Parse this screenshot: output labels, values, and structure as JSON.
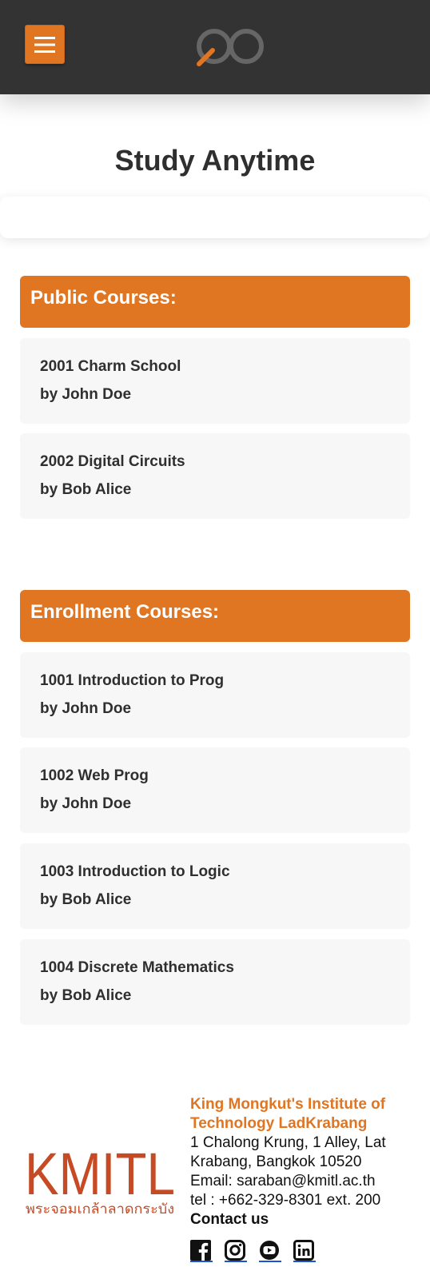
{
  "header": {
    "menu_icon": "hamburger-icon",
    "logo_icon": "infinity-logo-icon",
    "colors": {
      "bar": "#333333",
      "accent": "#e07522"
    }
  },
  "page": {
    "title": "Study Anytime"
  },
  "public_section": {
    "heading": "Public Courses:",
    "courses": [
      {
        "title": "2001 Charm School",
        "author": "by John Doe"
      },
      {
        "title": "2002 Digital Circuits",
        "author": "by Bob Alice"
      }
    ]
  },
  "enrollment_section": {
    "heading": "Enrollment Courses:",
    "courses": [
      {
        "title": "1001 Introduction to Prog",
        "author": "by John Doe"
      },
      {
        "title": "1002 Web Prog",
        "author": "by John Doe"
      },
      {
        "title": "1003 Introduction to Logic",
        "author": "by Bob Alice"
      },
      {
        "title": "1004 Discrete Mathematics",
        "author": "by Bob Alice"
      }
    ]
  },
  "footer": {
    "logo_text": "KMITL",
    "logo_subtext": "พระจอมเกล้าลาดกระบัง",
    "institution": "King Mongkut's Institute of Technology LadKrabang",
    "address": "1 Chalong Krung, 1 Alley, Lat Krabang, Bangkok 10520",
    "email": "Email: saraban@kmitl.ac.th",
    "tel": "tel : +662-329-8301 ext. 200",
    "contact_heading": "Contact us",
    "social_icons": [
      "facebook-icon",
      "instagram-icon",
      "youtube-icon",
      "linkedin-icon"
    ]
  }
}
